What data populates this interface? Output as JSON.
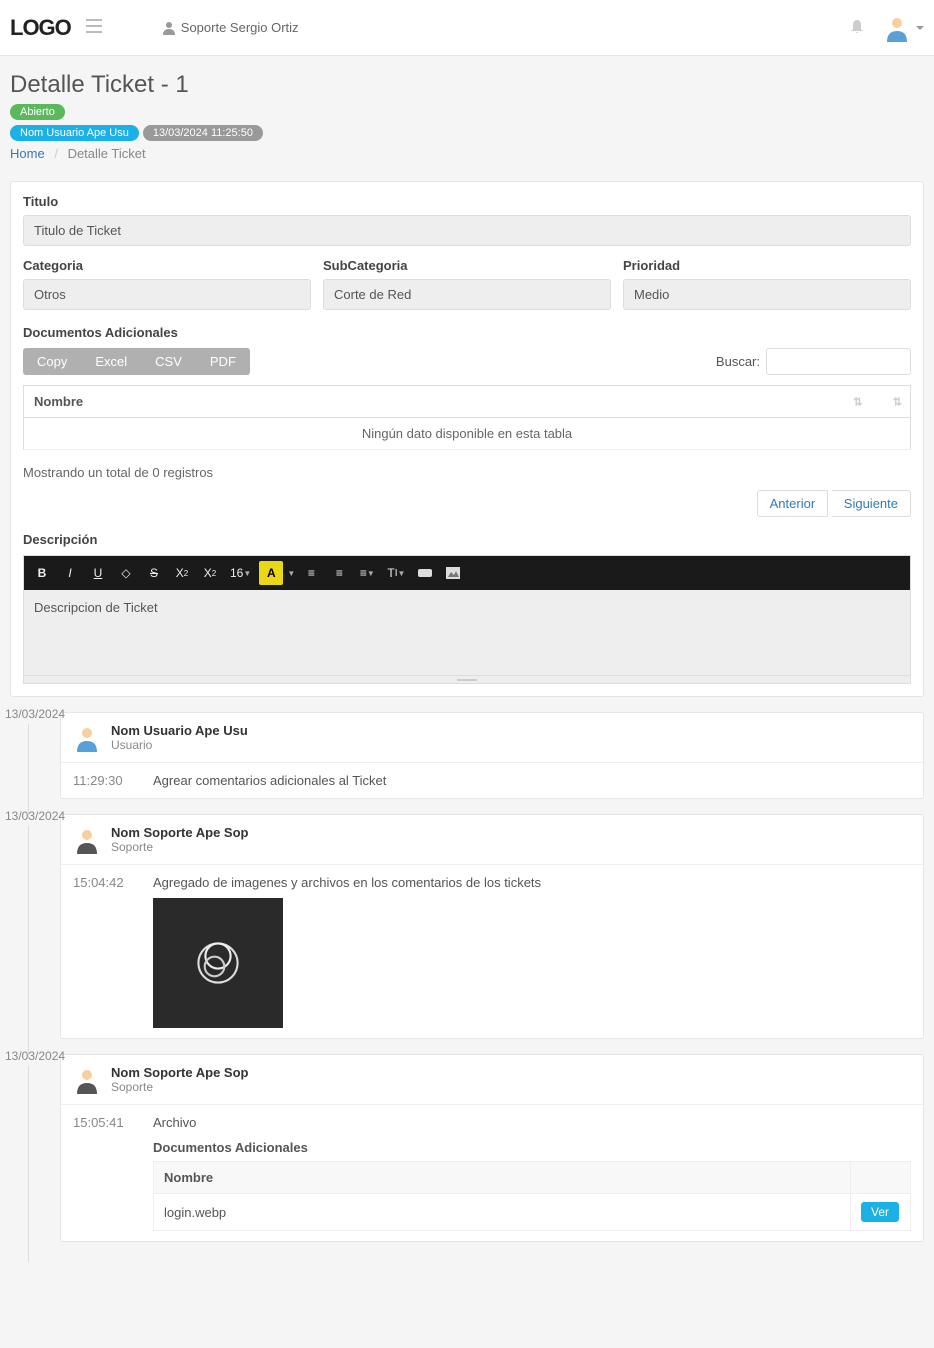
{
  "nav": {
    "logo": "LOGO",
    "user": "Soporte Sergio Ortiz"
  },
  "page": {
    "title": "Detalle Ticket - 1",
    "status_badge": "Abierto",
    "user_badge": "Nom Usuario Ape Usu",
    "date_badge": "13/03/2024 11:25:50",
    "breadcrumb_home": "Home",
    "breadcrumb_current": "Detalle Ticket"
  },
  "form": {
    "titulo_label": "Titulo",
    "titulo_value": "Titulo de Ticket",
    "categoria_label": "Categoria",
    "categoria_value": "Otros",
    "subcategoria_label": "SubCategoria",
    "subcategoria_value": "Corte de Red",
    "prioridad_label": "Prioridad",
    "prioridad_value": "Medio",
    "docs_label": "Documentos Adicionales",
    "export": {
      "copy": "Copy",
      "excel": "Excel",
      "csv": "CSV",
      "pdf": "PDF"
    },
    "search_label": "Buscar:",
    "table_header_nombre": "Nombre",
    "table_empty": "Ningún dato disponible en esta tabla",
    "table_info": "Mostrando un total de 0 registros",
    "pager_prev": "Anterior",
    "pager_next": "Siguiente",
    "desc_label": "Descripción",
    "desc_value": "Descripcion de Ticket",
    "font_size": "16"
  },
  "timeline": [
    {
      "date": "13/03/2024",
      "who": "Nom Usuario Ape Usu",
      "role": "Usuario",
      "avatar_style": "blue",
      "time": "11:29:30",
      "text": "Agrear comentarios adicionales al Ticket"
    },
    {
      "date": "13/03/2024",
      "who": "Nom Soporte Ape Sop",
      "role": "Soporte",
      "avatar_style": "dark",
      "time": "15:04:42",
      "text": "Agregado de imagenes y archivos en los comentarios de los tickets",
      "has_image": true
    },
    {
      "date": "13/03/2024",
      "who": "Nom Soporte Ape Sop",
      "role": "Soporte",
      "avatar_style": "dark",
      "time": "15:05:41",
      "text": "Archivo",
      "files_header": "Documentos Adicionales",
      "files_col": "Nombre",
      "files": [
        {
          "name": "login.webp",
          "action": "Ver"
        }
      ]
    }
  ]
}
